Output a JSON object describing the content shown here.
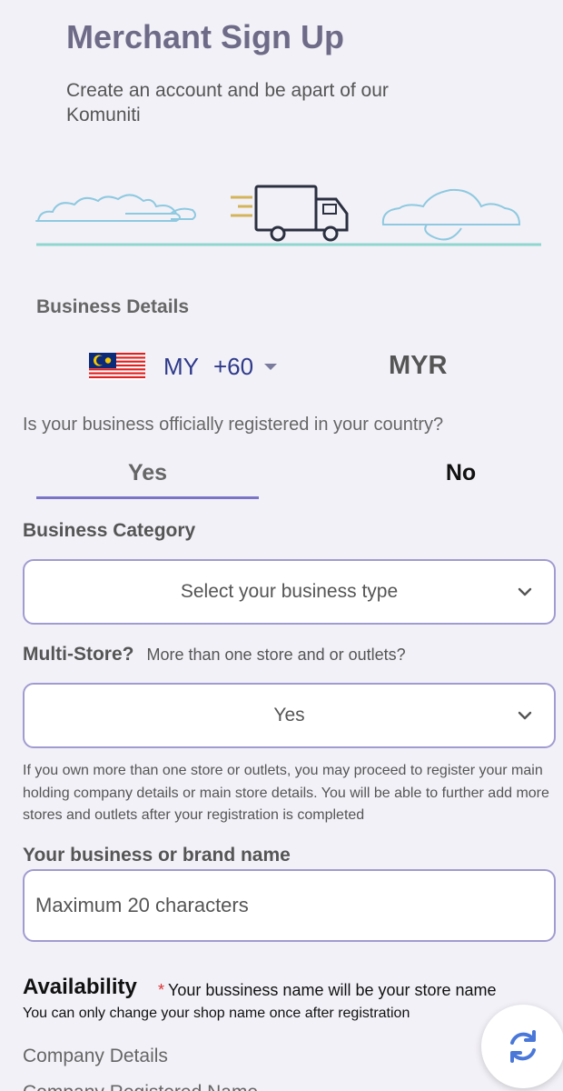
{
  "header": {
    "title": "Merchant Sign Up",
    "subtitle": "Create an account and be apart of our Komuniti"
  },
  "business_details": {
    "label": "Business Details",
    "country": {
      "flag": "malaysia-flag",
      "code": "MY",
      "dial": "+60"
    },
    "currency": "MYR"
  },
  "registration": {
    "question": "Is your business officially registered in your country?",
    "tabs": {
      "yes": "Yes",
      "no": "No",
      "selected": "Yes"
    }
  },
  "category": {
    "label": "Business Category",
    "placeholder": "Select your business type"
  },
  "multistore": {
    "label": "Multi-Store?",
    "hint": "More than one store and or outlets?",
    "value": "Yes",
    "info": "If you own more than one store or outlets, you may proceed to register your main holding company details or main store details. You will be able to further add more stores and outlets after your registration is completed"
  },
  "brand": {
    "label": "Your business or brand name",
    "placeholder": "Maximum 20 characters"
  },
  "availability": {
    "title": "Availability",
    "star": "*",
    "note": "Your bussiness name will be your store name",
    "sub": "You can only change your shop name once after registration"
  },
  "company": {
    "label": "Company Details",
    "next_label_partial": "Company Registered Name"
  },
  "colors": {
    "accent": "#7b75c7",
    "title": "#6e6b88",
    "link_blue": "#2f3a8a"
  },
  "icons": {
    "chevron": "chevron-down-icon",
    "refresh": "refresh-icon",
    "truck": "delivery-truck-icon",
    "cloud": "cloud-icon"
  }
}
